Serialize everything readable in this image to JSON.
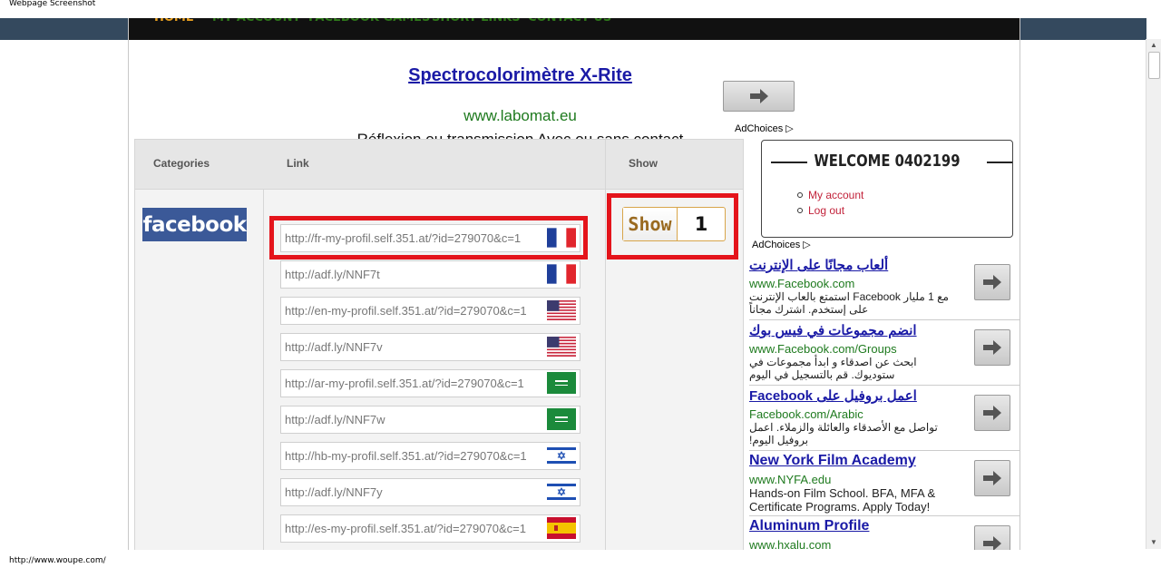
{
  "window_title": "Webpage Screenshot",
  "status_url": "http://www.woupe.com/",
  "nav": [
    "HOME",
    "MY ACCOUNT",
    "FACEBOOK GAMES",
    "SHORT LINKS",
    "CONTACT US"
  ],
  "top_ad": {
    "title": "Spectrocolorimètre X-Rite",
    "url": "www.labomat.eu",
    "desc": "Réflexion ou transmission Avec ou sans contact"
  },
  "adchoices": "AdChoices",
  "table": {
    "headers": {
      "categories": "Categories",
      "link": "Link",
      "show": "Show"
    },
    "category_logo": "facebook",
    "links": [
      {
        "url": "http://fr-my-profil.self.351.at/?id=279070&c=1",
        "flag": "fr-flag-icon"
      },
      {
        "url": "http://adf.ly/NNF7t",
        "flag": "fr-flag-icon"
      },
      {
        "url": "http://en-my-profil.self.351.at/?id=279070&c=1",
        "flag": "us-flag-icon"
      },
      {
        "url": "http://adf.ly/NNF7v",
        "flag": "us-flag-icon"
      },
      {
        "url": "http://ar-my-profil.self.351.at/?id=279070&c=1",
        "flag": "sa-flag-icon"
      },
      {
        "url": "http://adf.ly/NNF7w",
        "flag": "sa-flag-icon"
      },
      {
        "url": "http://hb-my-profil.self.351.at/?id=279070&c=1",
        "flag": "il-flag-icon"
      },
      {
        "url": "http://adf.ly/NNF7y",
        "flag": "il-flag-icon"
      },
      {
        "url": "http://es-my-profil.self.351.at/?id=279070&c=1",
        "flag": "es-flag-icon"
      }
    ],
    "show_label": "Show",
    "show_value": "1"
  },
  "welcome": {
    "title": "WELCOME 0402199",
    "links": [
      "My account",
      "Log out"
    ]
  },
  "side_ads": [
    {
      "title": "ألعاب مجانًا على الإنترنت",
      "url": "www.Facebook.com",
      "desc": "مع 1 مليار Facebook استمتع بالعاب الإنترنت على إستخدم. اشترك مجاناً",
      "rtl": true
    },
    {
      "title": "انضم مجموعات في فيس بوك",
      "url": "www.Facebook.com/Groups",
      "desc": "ابحث عن اصدقاء و ابدأ مجموعات في ستوديوك. قم بالتسجيل في اليوم",
      "rtl": true
    },
    {
      "title": "اعمل بروفيل على Facebook",
      "url": "Facebook.com/Arabic",
      "desc": "تواصل مع الأصدقاء والعائلة والزملاء. اعمل بروفيل اليوم!",
      "rtl": true
    },
    {
      "title": "New York Film Academy",
      "url": "www.NYFA.edu",
      "desc": "Hands-on Film School. BFA, MFA & Certificate Programs. Apply Today!",
      "rtl": false
    },
    {
      "title": "Aluminum Profile",
      "url": "www.hxalu.com",
      "desc": "",
      "rtl": false
    }
  ],
  "colors": {
    "nav_bg": "#111111",
    "top_bar": "#34495e",
    "facebook_blue": "#3b5998",
    "highlight_red": "#e4141b",
    "ad_link": "#1a1aa6",
    "ad_url": "#1e7a1e"
  }
}
